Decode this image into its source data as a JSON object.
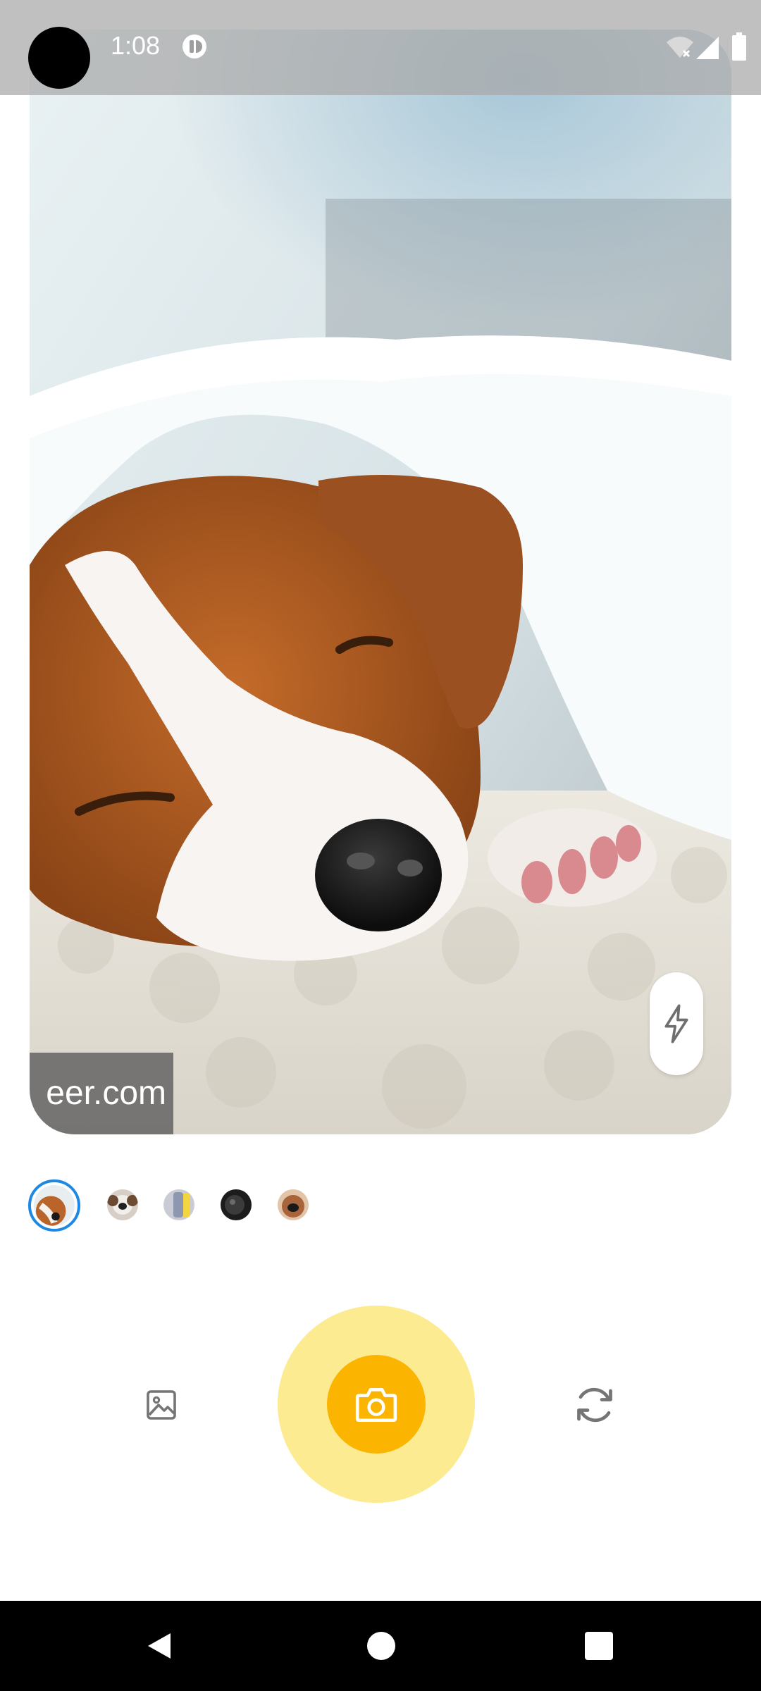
{
  "status_bar": {
    "time": "1:08",
    "icons": [
      "app-notification-icon",
      "wifi-icon",
      "signal-icon",
      "battery-icon"
    ]
  },
  "preview": {
    "subject": "sleeping-puppy-photo",
    "watermark_text": "eer.com",
    "flash_icon": "flash-icon"
  },
  "thumbnails": {
    "selected_index": 0,
    "items": [
      "puppy-thumbnail",
      "dog-face-thumbnail",
      "bottle-thumbnail",
      "dark-object-thumbnail",
      "puppy-nose-thumbnail"
    ]
  },
  "controls": {
    "gallery_icon": "image-icon",
    "shutter_icon": "camera-icon",
    "switch_icon": "switch-camera-icon"
  },
  "nav_bar": {
    "buttons": [
      "back",
      "home",
      "recents"
    ]
  },
  "colors": {
    "shutter": "#fbb400",
    "shutter_ring": "#fdeb91",
    "selection": "#1e88e5",
    "icon_gray": "#757575"
  }
}
